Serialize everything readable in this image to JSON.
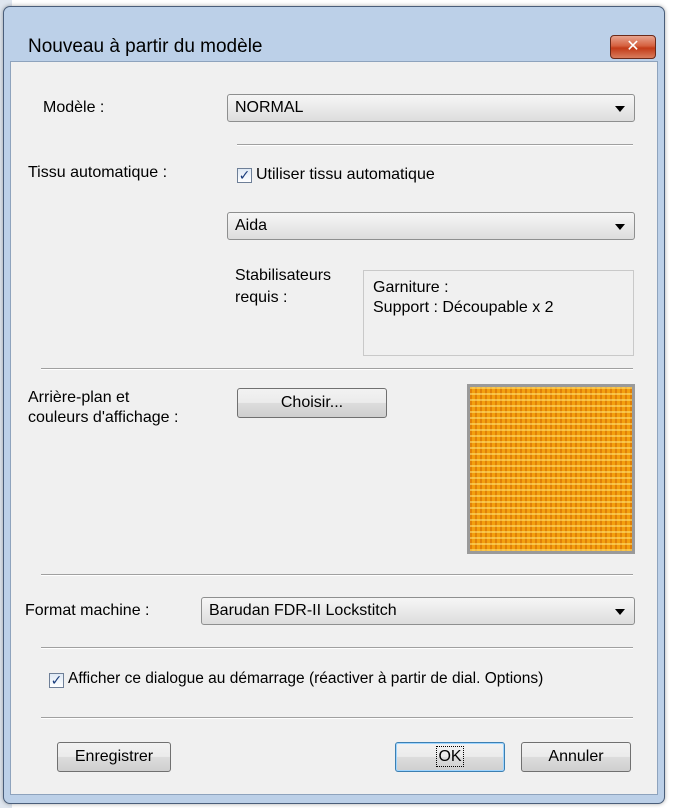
{
  "dialog": {
    "title": "Nouveau à partir du modèle",
    "close_glyph": "✕"
  },
  "model": {
    "label": "Modèle :",
    "value": "NORMAL"
  },
  "fabric": {
    "label": "Tissu automatique :",
    "auto_checkbox_label": "Utiliser tissu automatique",
    "auto_checked": true,
    "value": "Aida"
  },
  "stabilizers": {
    "label_line1": "Stabilisateurs",
    "label_line2": "requis :",
    "line1": "Garniture :",
    "line2": "Support : Découpable x 2"
  },
  "background": {
    "label_line1": "Arrière-plan et",
    "label_line2": "couleurs d'affichage :",
    "choose_label": "Choisir...",
    "preview_color": "#f3a00e"
  },
  "machine": {
    "label": "Format machine :",
    "value": "Barudan FDR-II Lockstitch"
  },
  "startup": {
    "checkbox_label": "Afficher ce dialogue au démarrage (réactiver à partir de dial. Options)",
    "checked": true
  },
  "buttons": {
    "save_label": "Enregistrer",
    "ok_label": "OK",
    "cancel_label": "Annuler"
  },
  "check_glyph": "✓"
}
